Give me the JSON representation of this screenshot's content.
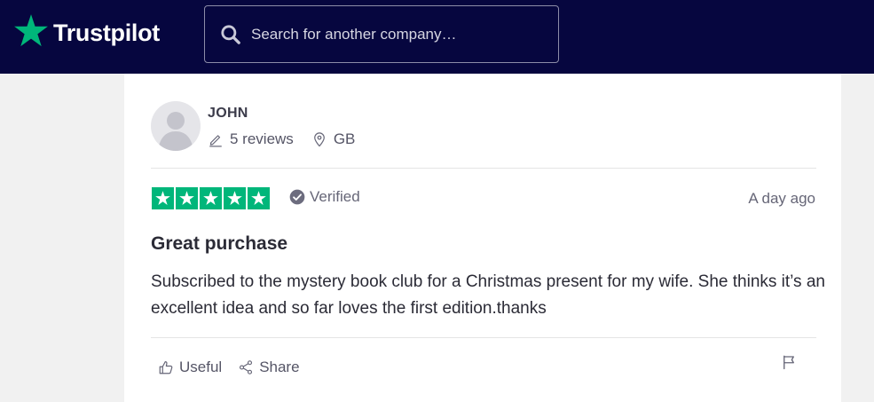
{
  "header": {
    "brand": "Trustpilot",
    "search_placeholder": "Search for another company…",
    "logo_icon": "star-icon",
    "search_icon": "search-icon"
  },
  "reviewer": {
    "name": "JOHN",
    "reviews_count": "5 reviews",
    "country": "GB",
    "avatar_icon": "person-silhouette-icon"
  },
  "review": {
    "rating": 5,
    "rating_max": 5,
    "verified_label": "Verified",
    "date": "A day ago",
    "title": "Great purchase",
    "body": "Subscribed to the mystery book club for a Christmas present for my wife. She thinks it’s an excellent idea and so far loves the first edition.thanks"
  },
  "actions": {
    "useful_label": "Useful",
    "share_label": "Share"
  },
  "colors": {
    "header_bg": "#06063f",
    "brand_green": "#00b67a",
    "page_bg": "#f1f1f1"
  }
}
